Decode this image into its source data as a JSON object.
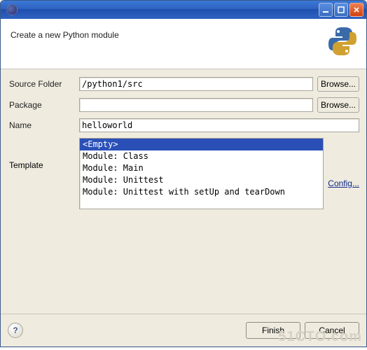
{
  "titlebar": {
    "title": ""
  },
  "header": {
    "heading": "Create a new Python module"
  },
  "form": {
    "source_folder": {
      "label": "Source Folder",
      "value": "/python1/src",
      "browse": "Browse..."
    },
    "package": {
      "label": "Package",
      "value": "",
      "browse": "Browse..."
    },
    "name": {
      "label": "Name",
      "value": "helloworld"
    },
    "template": {
      "label": "Template",
      "options": [
        "<Empty>",
        "Module: Class",
        "Module: Main",
        "Module: Unittest",
        "Module: Unittest with setUp and tearDown"
      ],
      "selected_index": 0,
      "config": "Config..."
    }
  },
  "footer": {
    "help": "?",
    "finish": "Finish",
    "cancel": "Cancel"
  },
  "watermark": "51CTO.com"
}
